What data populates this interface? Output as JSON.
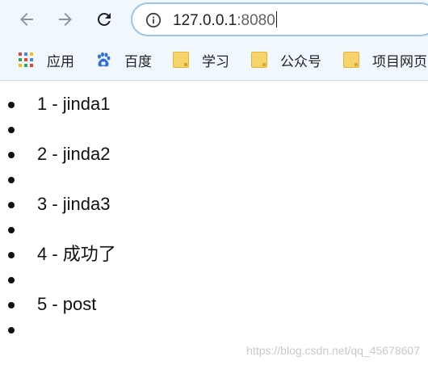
{
  "browser": {
    "url_host": "127.0.0.1",
    "url_port": ":8080"
  },
  "bookmarks": [
    {
      "label": "应用",
      "icon": "apps-grid-icon"
    },
    {
      "label": "百度",
      "icon": "baidu-paw-icon"
    },
    {
      "label": "学习",
      "icon": "folder-icon"
    },
    {
      "label": "公众号",
      "icon": "folder-icon"
    },
    {
      "label": "项目网页",
      "icon": "folder-icon"
    }
  ],
  "list": [
    {
      "text": "1 - jinda1"
    },
    {
      "text": ""
    },
    {
      "text": "2 - jinda2"
    },
    {
      "text": ""
    },
    {
      "text": "3 - jinda3"
    },
    {
      "text": ""
    },
    {
      "text": "4 - 成功了"
    },
    {
      "text": ""
    },
    {
      "text": "5 - post"
    },
    {
      "text": ""
    }
  ],
  "watermark": "https://blog.csdn.net/qq_45678607",
  "colors": {
    "chrome_bg": "#f1f8fd",
    "omnibox_border": "#9cc6ea",
    "folder": "#f7d36b"
  }
}
